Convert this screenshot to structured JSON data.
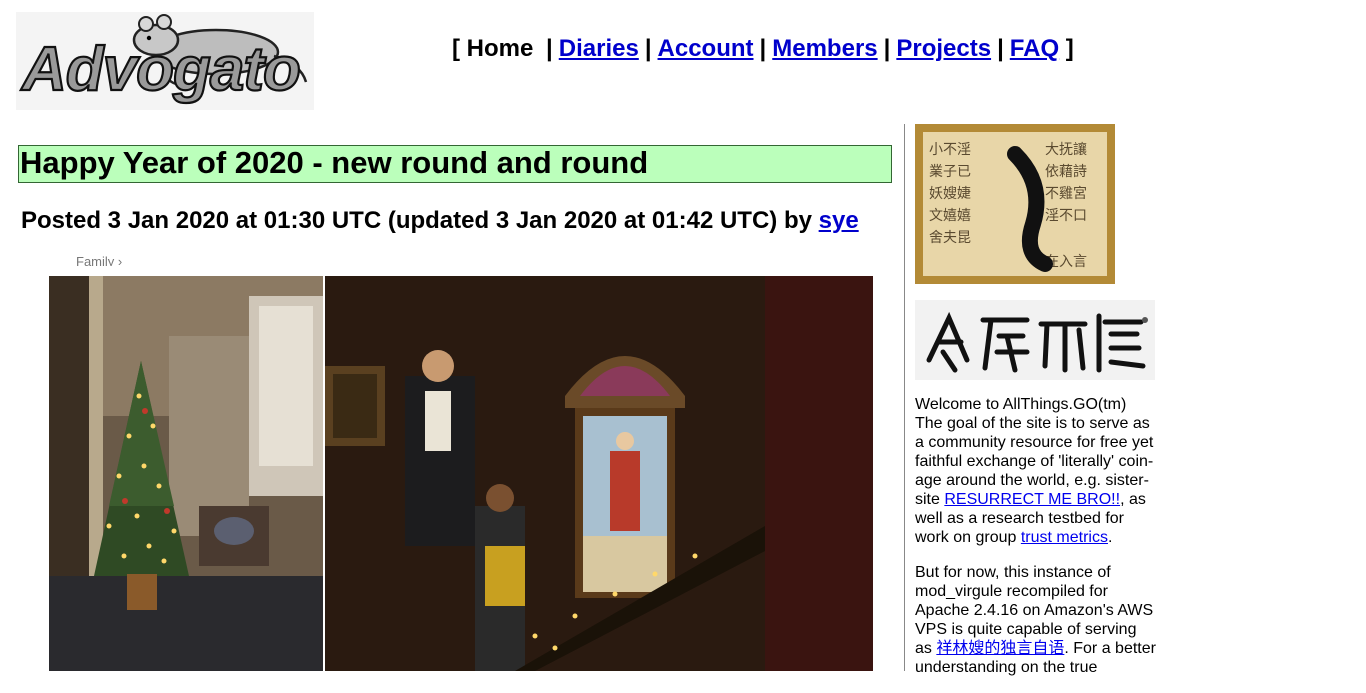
{
  "logo": {
    "text": "Advogato"
  },
  "nav": {
    "open_bracket": "[",
    "close_bracket": "]",
    "separator": "|",
    "home": "Home",
    "diaries": "Diaries",
    "account": "Account",
    "members": "Members",
    "projects": "Projects",
    "faq": "FAQ"
  },
  "article": {
    "title": "Happy Year of 2020 - new round and round",
    "posted_prefix": "Posted 3 Jan 2020 at 01:30 UTC (updated 3 Jan 2020 at 01:42 UTC) by",
    "author": "sye",
    "caption_crop": "Family ›"
  },
  "sidebar": {
    "p1_a": "Welcome to AllThings.GO(tm) The goal of the site is to serve as a community resource for free yet faithful exchange of 'literally' coin-age around the world, e.g. sister-site ",
    "p1_link1": "RESURRECT ME BRO!!",
    "p1_b": ", as well as a research testbed for work on group ",
    "p1_link2": "trust metrics",
    "p1_c": ".",
    "p2_a": "But for now, this instance of mod_virgule recompiled for Apache 2.4.16 on Amazon's AWS VPS is quite capable of serving as ",
    "p2_link": "祥林嫂的独言自语",
    "p2_b": ". For a better understanding on the true"
  },
  "colors": {
    "title_bg": "#bbffbb",
    "link": "#0000ee"
  }
}
